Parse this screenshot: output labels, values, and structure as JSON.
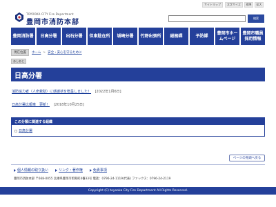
{
  "header": {
    "logo_en": "TOYOOKA CITY Fire Department",
    "title": "豊岡市消防本部",
    "utility": {
      "sitemap": "サイトマップ",
      "font_size": "文字サイズ",
      "standard": "標準",
      "large": "拡大"
    },
    "search": {
      "placeholder": "",
      "button_label": "検索"
    }
  },
  "nav": {
    "items": [
      "豊岡消防署",
      "日高分署",
      "出石分署",
      "但東駐在所",
      "城崎分署",
      "竹野出張所",
      "総務課",
      "予防課",
      "豊岡市ホー\nムページ",
      "豊岡市職員\n採用情報"
    ]
  },
  "breadcrumb": {
    "tag": "現在位置",
    "home": "ホーム",
    "separator": ">",
    "current": "安全・安心を守るために"
  },
  "back_label": "あしあと",
  "page_title": "日高分署",
  "articles": [
    {
      "title": "消防協力者（人命救助）に感謝状を贈呈しました！",
      "date": "[2022年1月6日]"
    },
    {
      "title": "日高分署広報車　更新！",
      "date": "[2018年10月25日]"
    }
  ],
  "related": {
    "heading": "この分類に関連する組織",
    "item": "日高分署"
  },
  "pagetop_label": "ページの先頭へ戻る",
  "footer": {
    "links": [
      "個人情報の取り扱い",
      "リンク・著作権",
      "免責事項"
    ],
    "address": "豊岡市消防本部 〒668-0055 兵庫県豊岡市昭和町4番33号 電話：0796-24-1119(代表) ファックス：0796-24-2119",
    "copyright": "Copyright (C) toyooka City Fire Department All Rights Reserved."
  },
  "colors": {
    "brand_blue": "#24409a",
    "link": "#1a3e9a"
  }
}
